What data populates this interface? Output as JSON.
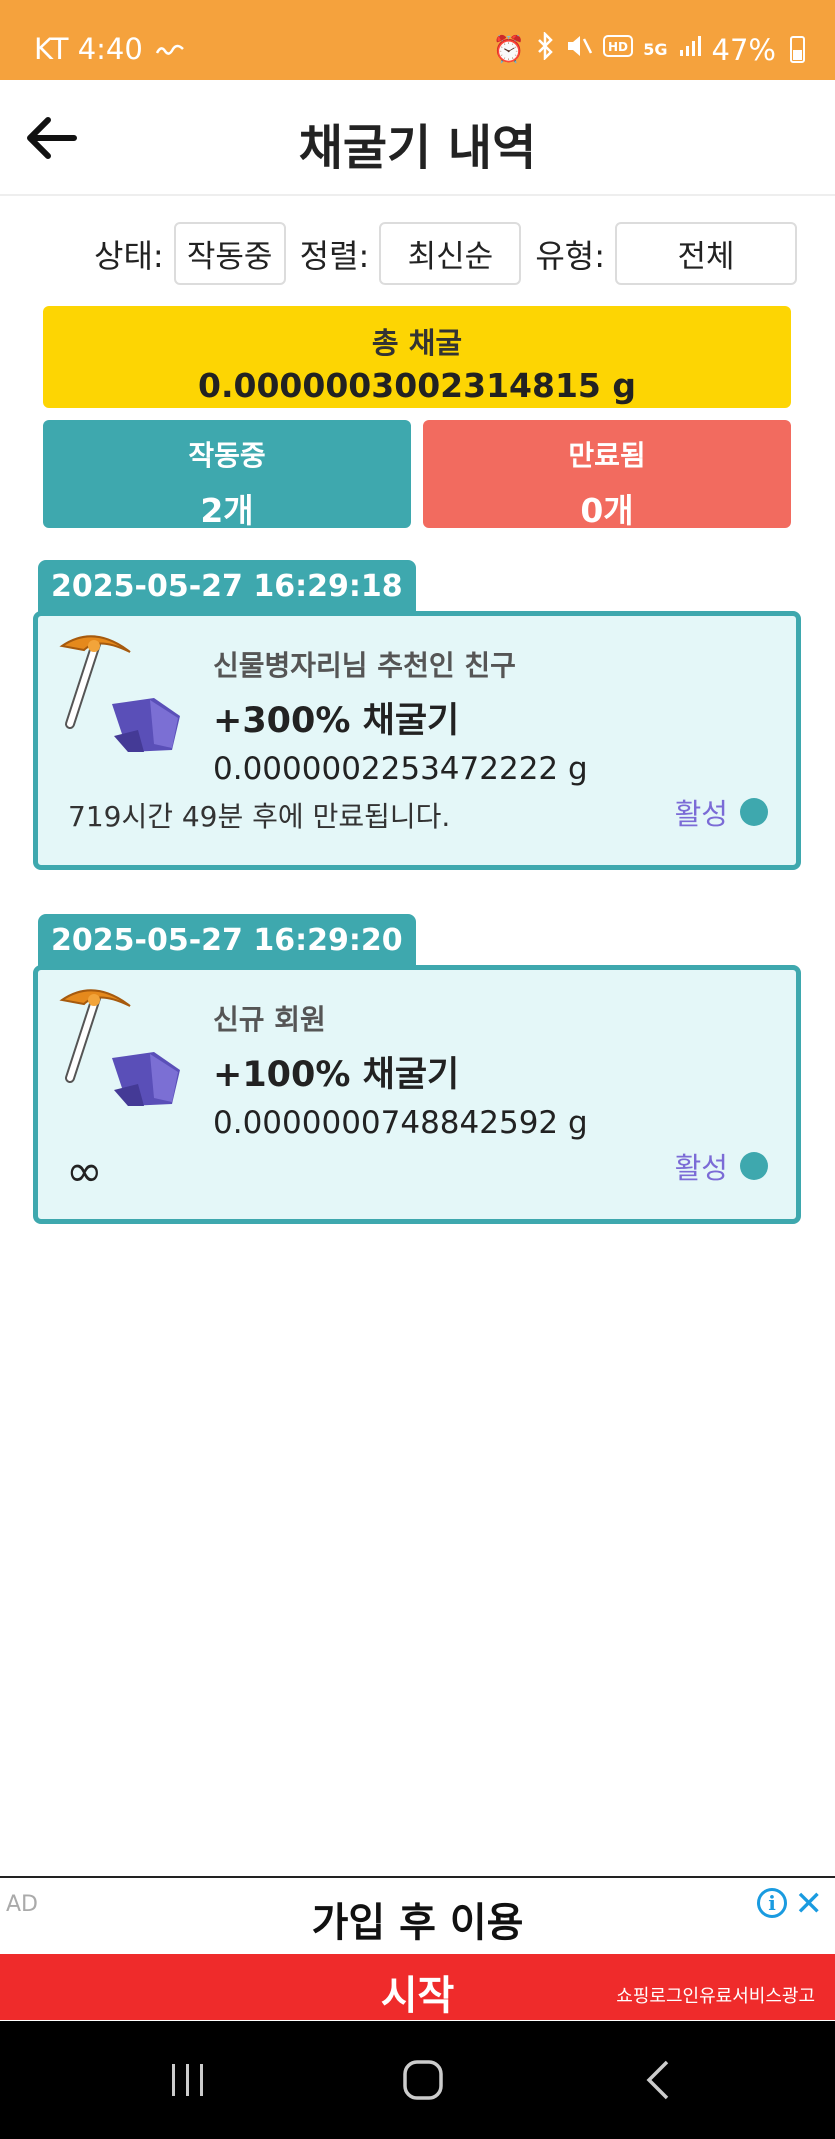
{
  "status_bar": {
    "carrier_time": "KT 4:40",
    "network": "5G",
    "battery": "47%"
  },
  "header": {
    "title": "채굴기 내역",
    "back_icon": "arrow-left-icon"
  },
  "filters": {
    "status_label": "상태:",
    "status_value": "작동중",
    "sort_label": "정렬:",
    "sort_value": "최신순",
    "type_label": "유형:",
    "type_value": "전체"
  },
  "summary": {
    "total_label": "총 채굴",
    "total_value": "0.0000003002314815 g",
    "active_label": "작동중",
    "active_count": "2개",
    "expired_label": "만료됨",
    "expired_count": "0개"
  },
  "miners": [
    {
      "date": "2025-05-27 16:29:18",
      "source": "신물병자리님 추천인 친구",
      "boost": "+300% 채굴기",
      "amount": "0.0000002253472222 g",
      "expires": "719시간 49분 후에 만료됩니다.",
      "status": "활성"
    },
    {
      "date": "2025-05-27 16:29:20",
      "source": "신규 회원",
      "boost": "+100% 채굴기",
      "amount": "0.0000000748842592 g",
      "expires": "∞",
      "status": "활성"
    }
  ],
  "ad": {
    "tag": "AD",
    "headline": "가입 후 이용",
    "info_icon": "i",
    "close_icon": "✕",
    "cta": "시작",
    "sub": "쇼핑로그인유료서비스광고"
  },
  "colors": {
    "status_bar": "#f5a23d",
    "total": "#fdd503",
    "active": "#3ea8ae",
    "expired": "#f26b5f",
    "card_bg": "#e4f7f8",
    "status_text": "#7b6bd6",
    "ad_cta": "#ef2b2b"
  }
}
